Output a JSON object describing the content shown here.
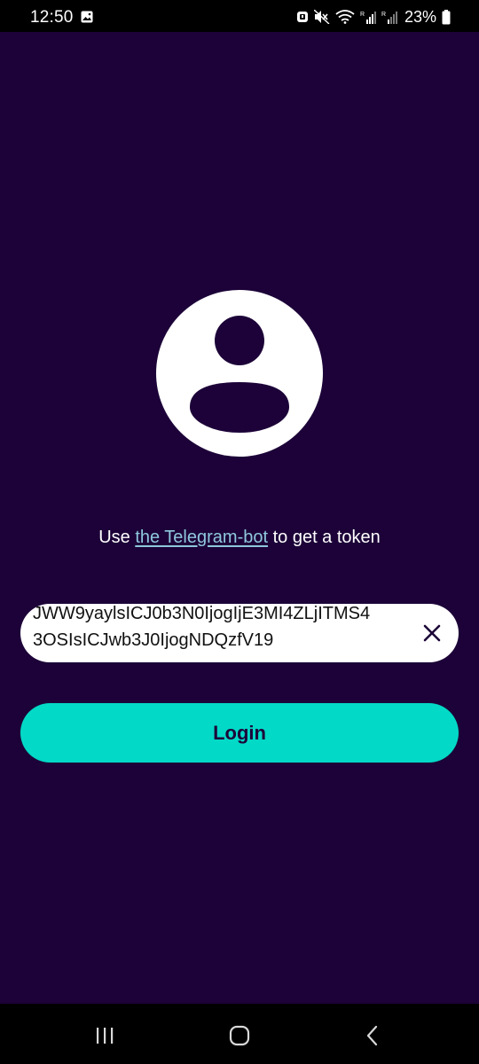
{
  "status_bar": {
    "time": "12:50",
    "battery": "23%",
    "icons": [
      "gallery-icon",
      "alarm-icon",
      "mute-icon",
      "wifi-icon",
      "signal-icon",
      "signal-icon",
      "battery-icon"
    ]
  },
  "avatar": {
    "icon": "user-avatar-icon"
  },
  "hint": {
    "prefix": "Use ",
    "link_text": "the Telegram-bot",
    "suffix": " to get a token"
  },
  "token_field": {
    "value": "JWW9yaylsICJ0b3N0IjogIjE3MI4ZLjITMS4\n3OSIsICJwb3J0IjogNDQzfV19",
    "clear_icon": "close-icon"
  },
  "login_button": {
    "label": "Login"
  },
  "nav_bar": {
    "buttons": [
      "recent-apps-icon",
      "home-icon",
      "back-icon"
    ]
  },
  "colors": {
    "background": "#1c0238",
    "accent": "#03d9c7",
    "link": "#8fc8de",
    "field_background": "#ffffff"
  }
}
